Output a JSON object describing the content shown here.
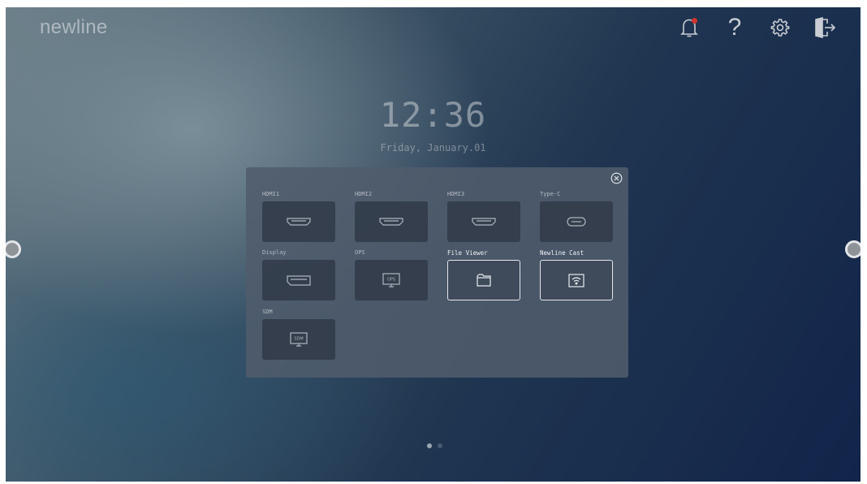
{
  "brand": {
    "logo": "newline"
  },
  "topbar": {
    "icons": [
      "notification-bell-icon",
      "help-icon",
      "settings-gear-icon",
      "exit-door-icon"
    ],
    "help_glyph": "?",
    "notification_dot_color": "#d0342c"
  },
  "clock": {
    "time": "12:36",
    "date": "Friday, January.01"
  },
  "source_panel": {
    "sources": [
      {
        "label": "HDMI1",
        "icon": "hdmi-port-icon"
      },
      {
        "label": "HDMI2",
        "icon": "hdmi-port-icon"
      },
      {
        "label": "HDMI3",
        "icon": "hdmi-port-icon"
      },
      {
        "label": "Type-C",
        "icon": "usb-c-port-icon"
      },
      {
        "label": "Display",
        "icon": "displayport-icon"
      },
      {
        "label": "OPS",
        "icon": "ops-monitor-icon",
        "icon_text": "OPS"
      },
      {
        "label": "File Viewer",
        "icon": "folder-icon",
        "selected": true
      },
      {
        "label": "Newline Cast",
        "icon": "cast-screen-icon",
        "selected": true
      },
      {
        "label": "SDM",
        "icon": "sdm-monitor-icon",
        "icon_text": "SDM"
      }
    ]
  },
  "pager": {
    "pages": 2,
    "current": 1
  },
  "colors": {
    "accent_border": "#e4e7ea",
    "panel_bg": "#505c6c"
  }
}
